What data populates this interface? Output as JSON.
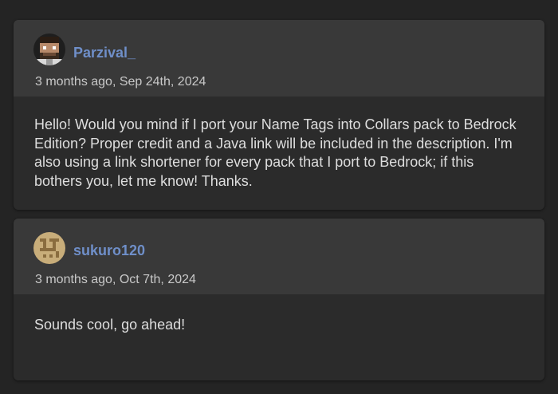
{
  "comments": [
    {
      "author": "Parzival_",
      "avatar_icon": "pixel-bearded-man-avatar",
      "timestamp": "3 months ago, Sep 24th, 2024",
      "body": "Hello! Would you mind if I port your Name Tags into Collars pack to Bedrock Edition? Proper credit and a Java link will be included in the description. I'm also using a link shortener for every pack that I port to Bedrock; if this bothers you, let me know! Thanks."
    },
    {
      "author": "sukuro120",
      "avatar_icon": "pixel-pattern-avatar",
      "timestamp": "3 months ago, Oct 7th, 2024",
      "body": "Sounds cool, go ahead!"
    }
  ],
  "colors": {
    "background": "#242424",
    "card": "#2b2b2b",
    "card_header": "#393939",
    "author_link": "#6f8fc9",
    "timestamp": "#c8c8c8",
    "body_text": "#dedede"
  }
}
